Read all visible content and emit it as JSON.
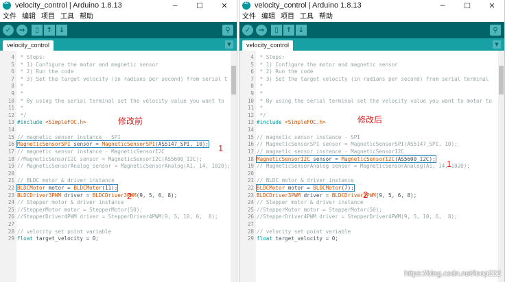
{
  "windows": [
    {
      "title": "velocity_control | Arduino 1.8.13",
      "menus": [
        "文件",
        "编辑",
        "项目",
        "工具",
        "帮助"
      ],
      "tab_label": "velocity_control",
      "annotation": "修改前",
      "lines": [
        {
          "num": "4",
          "segs": [
            {
              "t": " * Steps:",
              "c": "c"
            }
          ]
        },
        {
          "num": "5",
          "segs": [
            {
              "t": " * 1) Configure the motor and magnetic sensor",
              "c": "c"
            }
          ]
        },
        {
          "num": "6",
          "segs": [
            {
              "t": " * 2) Run the code",
              "c": "c"
            }
          ]
        },
        {
          "num": "7",
          "segs": [
            {
              "t": " * 3) Set the target velocity (in radians per second) from serial t",
              "c": "c"
            }
          ]
        },
        {
          "num": "8",
          "segs": [
            {
              "t": " *",
              "c": "c"
            }
          ]
        },
        {
          "num": "9",
          "segs": [
            {
              "t": " *",
              "c": "c"
            }
          ]
        },
        {
          "num": "10",
          "segs": [
            {
              "t": " * By using the serial terminal set the velocity value you want to",
              "c": "c"
            }
          ]
        },
        {
          "num": "11",
          "segs": [
            {
              "t": " *",
              "c": "c"
            }
          ]
        },
        {
          "num": "12",
          "segs": [
            {
              "t": " */",
              "c": "c"
            }
          ]
        },
        {
          "num": "13",
          "segs": [
            {
              "t": "#include ",
              "c": "k"
            },
            {
              "t": "<SimpleFOC.h>",
              "c": "t"
            }
          ]
        },
        {
          "num": "14",
          "segs": []
        },
        {
          "num": "15",
          "segs": [
            {
              "t": "// magnetic sensor instance - SPI",
              "c": "c"
            }
          ]
        },
        {
          "num": "16",
          "hl": true,
          "segs": [
            {
              "t": "MagneticSensorSPI",
              "c": "t"
            },
            {
              "t": " sensor = ",
              "c": ""
            },
            {
              "t": "MagneticSensorSPI",
              "c": "t"
            },
            {
              "t": "(AS5147_SPI, 10);",
              "c": ""
            }
          ]
        },
        {
          "num": "17",
          "segs": [
            {
              "t": "// magnetic sensor instance - MagneticSensorI2C",
              "c": "c"
            }
          ]
        },
        {
          "num": "18",
          "segs": [
            {
              "t": "//MagneticSensorI2C sensor = MagneticSensorI2C(AS5600_I2C);",
              "c": "c"
            }
          ]
        },
        {
          "num": "19",
          "segs": [
            {
              "t": "// MagneticSensorAnalog sensor = MagneticSensorAnalog(A1, 14, 1020);",
              "c": "c"
            }
          ]
        },
        {
          "num": "20",
          "segs": []
        },
        {
          "num": "21",
          "segs": [
            {
              "t": "// BLDC motor & driver instance",
              "c": "c"
            }
          ]
        },
        {
          "num": "22",
          "hl": true,
          "segs": [
            {
              "t": "BLDCMotor",
              "c": "t"
            },
            {
              "t": " motor = ",
              "c": ""
            },
            {
              "t": "BLDCMotor",
              "c": "t"
            },
            {
              "t": "(11);",
              "c": ""
            }
          ]
        },
        {
          "num": "23",
          "segs": [
            {
              "t": "BLDCDriver3PWM",
              "c": "t"
            },
            {
              "t": " driver = ",
              "c": ""
            },
            {
              "t": "BLDCDriver3PWM",
              "c": "t"
            },
            {
              "t": "(9, 5, 6, 8);",
              "c": ""
            }
          ]
        },
        {
          "num": "24",
          "segs": [
            {
              "t": "// Stepper motor & driver instance",
              "c": "c"
            }
          ]
        },
        {
          "num": "25",
          "segs": [
            {
              "t": "//StepperMotor motor = StepperMotor(50);",
              "c": "c"
            }
          ]
        },
        {
          "num": "26",
          "segs": [
            {
              "t": "//StepperDriver4PWM driver = StepperDriver4PWM(9, 5, 10, 6,  8);",
              "c": "c"
            }
          ]
        },
        {
          "num": "27",
          "segs": []
        },
        {
          "num": "28",
          "segs": [
            {
              "t": "// velocity set point variable",
              "c": "c"
            }
          ]
        },
        {
          "num": "29",
          "segs": [
            {
              "t": "float",
              "c": "k"
            },
            {
              "t": " target_velocity = 0;",
              "c": ""
            }
          ]
        }
      ],
      "marks": [
        "1",
        "2"
      ]
    },
    {
      "title": "velocity_control | Arduino 1.8.13",
      "menus": [
        "文件",
        "编辑",
        "项目",
        "工具",
        "帮助"
      ],
      "tab_label": "velocity_control",
      "annotation": "修改后",
      "lines": [
        {
          "num": "4",
          "segs": [
            {
              "t": " * Steps:",
              "c": "c"
            }
          ]
        },
        {
          "num": "5",
          "segs": [
            {
              "t": " * 1) Configure the motor and magnetic sensor",
              "c": "c"
            }
          ]
        },
        {
          "num": "6",
          "segs": [
            {
              "t": " * 2) Run the code",
              "c": "c"
            }
          ]
        },
        {
          "num": "7",
          "segs": [
            {
              "t": " * 3) Set the target velocity (in radians per second) from serial terminal",
              "c": "c"
            }
          ]
        },
        {
          "num": "8",
          "segs": [
            {
              "t": " *",
              "c": "c"
            }
          ]
        },
        {
          "num": "9",
          "segs": [
            {
              "t": " *",
              "c": "c"
            }
          ]
        },
        {
          "num": "10",
          "segs": [
            {
              "t": " * By using the serial terminal set the velocity value you want to motor to",
              "c": "c"
            }
          ]
        },
        {
          "num": "11",
          "segs": [
            {
              "t": " *",
              "c": "c"
            }
          ]
        },
        {
          "num": "12",
          "segs": [
            {
              "t": " */",
              "c": "c"
            }
          ]
        },
        {
          "num": "13",
          "segs": [
            {
              "t": "#include ",
              "c": "k"
            },
            {
              "t": "<SimpleFOC.h>",
              "c": "t"
            }
          ]
        },
        {
          "num": "14",
          "segs": []
        },
        {
          "num": "15",
          "segs": [
            {
              "t": "// magnetic sensor instance - SPI",
              "c": "c"
            }
          ]
        },
        {
          "num": "16",
          "segs": [
            {
              "t": "// MagneticSensorSPI sensor = MagneticSensorSPI(AS5147_SPI, 10);",
              "c": "c"
            }
          ]
        },
        {
          "num": "17",
          "segs": [
            {
              "t": "// magnetic sensor instance - MagneticSensorI2C",
              "c": "c"
            }
          ]
        },
        {
          "num": "18",
          "hl": true,
          "segs": [
            {
              "t": "MagneticSensorI2C",
              "c": "t"
            },
            {
              "t": " sensor = ",
              "c": ""
            },
            {
              "t": "MagneticSensorI2C",
              "c": "t"
            },
            {
              "t": "(AS5600_I2C);",
              "c": ""
            }
          ]
        },
        {
          "num": "19",
          "segs": [
            {
              "t": "// MagneticSensorAnalog sensor = MagneticSensorAnalog(A1, 14, 1020);",
              "c": "c"
            }
          ]
        },
        {
          "num": "20",
          "segs": []
        },
        {
          "num": "21",
          "segs": [
            {
              "t": "// BLDC motor & driver instance",
              "c": "c"
            }
          ]
        },
        {
          "num": "22",
          "hl": true,
          "segs": [
            {
              "t": "BLDCMotor",
              "c": "t"
            },
            {
              "t": " motor = ",
              "c": ""
            },
            {
              "t": "BLDCMotor",
              "c": "t"
            },
            {
              "t": "(7);",
              "c": ""
            }
          ]
        },
        {
          "num": "23",
          "segs": [
            {
              "t": "BLDCDriver3PWM",
              "c": "t"
            },
            {
              "t": " driver = ",
              "c": ""
            },
            {
              "t": "BLDCDriver3PWM",
              "c": "t"
            },
            {
              "t": "(9, 5, 6, 8);",
              "c": ""
            }
          ]
        },
        {
          "num": "24",
          "segs": [
            {
              "t": "// Stepper motor & driver instance",
              "c": "c"
            }
          ]
        },
        {
          "num": "25",
          "segs": [
            {
              "t": "//StepperMotor motor = StepperMotor(50);",
              "c": "c"
            }
          ]
        },
        {
          "num": "26",
          "segs": [
            {
              "t": "//StepperDriver4PWM driver = StepperDriver4PWM(9, 5, 10, 6,  8);",
              "c": "c"
            }
          ]
        },
        {
          "num": "27",
          "segs": []
        },
        {
          "num": "28",
          "segs": [
            {
              "t": "// velocity set point variable",
              "c": "c"
            }
          ]
        },
        {
          "num": "29",
          "segs": [
            {
              "t": "float",
              "c": "k"
            },
            {
              "t": " target_velocity = 0;",
              "c": ""
            }
          ]
        }
      ],
      "marks": [
        "1",
        "2"
      ]
    }
  ],
  "watermark": "https://blog.csdn.net/loop222",
  "icons": {
    "window_controls": [
      "minimize-icon",
      "maximize-icon",
      "close-icon"
    ],
    "toolbar": [
      "verify-icon",
      "upload-icon",
      "new-icon",
      "open-icon",
      "save-icon",
      "serial-monitor-icon"
    ],
    "tab_menu": "tab-menu-icon"
  },
  "colors": {
    "toolbar": "#006468",
    "tabbar": "#17a1a5",
    "type": "#d35400",
    "keyword": "#00979c",
    "comment": "#95a5a6",
    "annotation": "#e0201e",
    "highlight_box": "#2b8cc4"
  }
}
